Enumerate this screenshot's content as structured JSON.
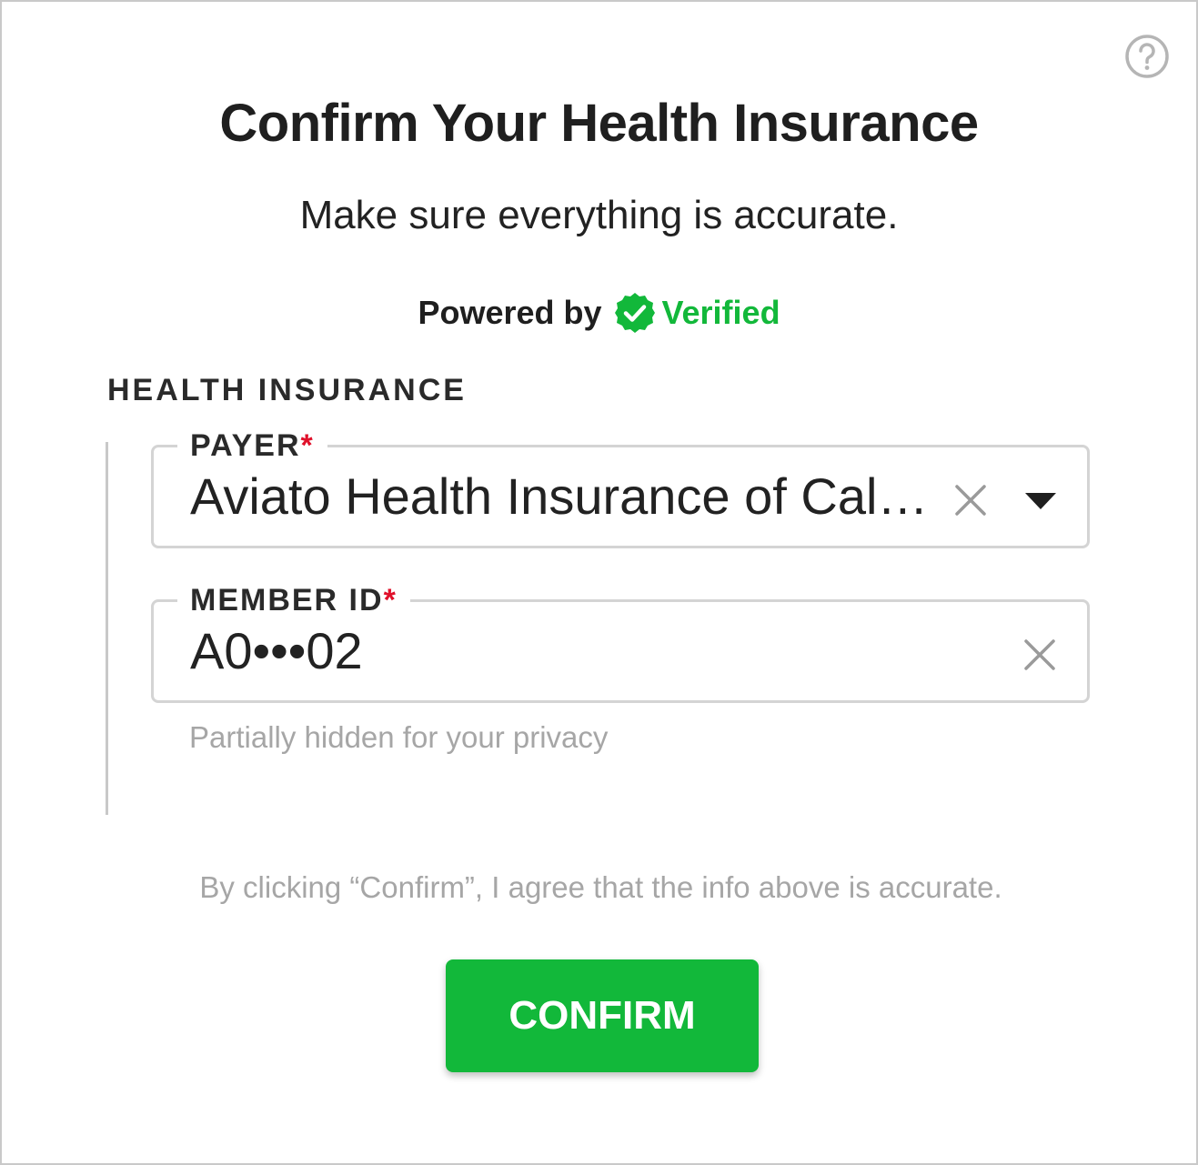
{
  "dialog": {
    "title": "Confirm Your Health Insurance",
    "subtitle": "Make sure everything is accurate.",
    "powered_by": "Powered by",
    "brand": "Verified",
    "help_icon": "question-circle-icon"
  },
  "section": {
    "label": "HEALTH INSURANCE"
  },
  "payer": {
    "label": "PAYER",
    "required_mark": "*",
    "value": "Aviato Health Insurance of Cal…"
  },
  "member_id": {
    "label": "MEMBER ID",
    "required_mark": "*",
    "value": "A0•••02",
    "hint": "Partially hidden for your privacy"
  },
  "footer": {
    "agreement": "By clicking “Confirm”, I agree that the info above is accurate.",
    "confirm_label": "CONFIRM"
  },
  "colors": {
    "brand_green": "#12b83a",
    "required_red": "#e0102a",
    "border_gray": "#d4d4d4",
    "hint_gray": "#a6a6a6"
  }
}
